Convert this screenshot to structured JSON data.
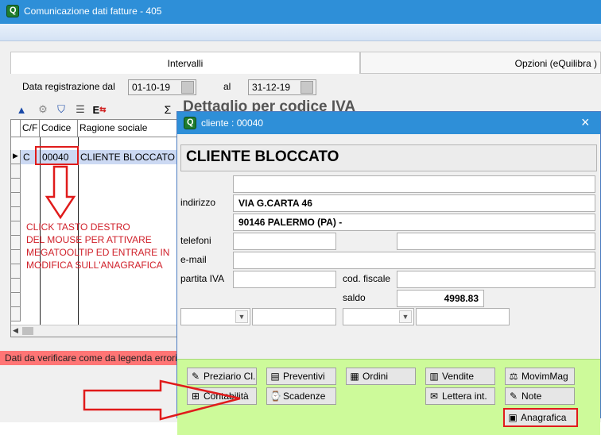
{
  "window": {
    "title": "Comunicazione dati fatture - 405"
  },
  "tabs": [
    {
      "label": "Intervalli"
    },
    {
      "label": "Opzioni (eQuilibra )"
    }
  ],
  "filter": {
    "date_label": "Data registrazione dal",
    "date_from": "01-10-19",
    "to_label": "al",
    "date_to": "31-12-19"
  },
  "toolbar": {
    "sigma": "Σ",
    "edit_label": "E"
  },
  "background_heading": "Dettaglio per codice IVA",
  "grid": {
    "columns": [
      "C/F",
      "Codice",
      "Ragione sociale"
    ],
    "rows": [
      {
        "cf": "C",
        "codice": "00040",
        "ragione": "CLIENTE BLOCCATO"
      }
    ]
  },
  "annotation": {
    "text_lines": [
      "CLICK TASTO DESTRO",
      "DEL MOUSE PER ATTIVARE",
      "MEGATOOLTIP ED ENTRARE IN",
      "MODIFICA SULL'ANAGRAFICA"
    ]
  },
  "status": {
    "error_text": "Dati da verificare come da legenda errori"
  },
  "popup": {
    "title": "cliente : 00040",
    "name": "CLIENTE BLOCCATO",
    "labels": {
      "indirizzo": "indirizzo",
      "telefoni": "telefoni",
      "email": "e-mail",
      "partita_iva": "partita IVA",
      "cod_fiscale": "cod. fiscale",
      "saldo": "saldo"
    },
    "values": {
      "address1": "",
      "address2": "VIA G.CARTA 46",
      "address3": "90146 PALERMO (PA) -",
      "telefono1": "",
      "telefono2": "",
      "email": "",
      "partita_iva": "",
      "cod_fiscale": "",
      "saldo": "4998.83"
    },
    "buttons": {
      "preziario": "Preziario Cl.",
      "preventivi": "Preventivi",
      "ordini": "Ordini",
      "vendite": "Vendite",
      "movimmag": "MovimMag",
      "contabilita": "Contabilità",
      "scadenze": "Scadenze",
      "lettera": "Lettera int.",
      "note": "Note",
      "anagrafica": "Anagrafica"
    }
  },
  "colors": {
    "accent": "#2e8fd8",
    "annotation_red": "#e01b1b",
    "panel_green": "#cdfa9a",
    "error_bar": "#ff7575"
  }
}
